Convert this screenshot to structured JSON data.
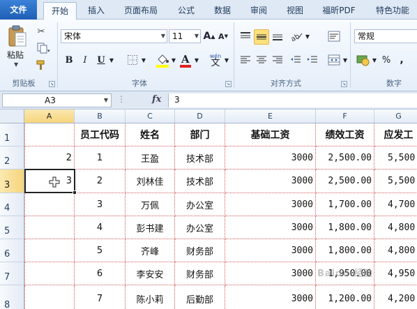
{
  "tabs": [
    {
      "label": "文件"
    },
    {
      "label": "开始"
    },
    {
      "label": "插入"
    },
    {
      "label": "页面布局"
    },
    {
      "label": "公式"
    },
    {
      "label": "数据"
    },
    {
      "label": "审阅"
    },
    {
      "label": "视图"
    },
    {
      "label": "福昕PDF"
    },
    {
      "label": "特色功能"
    }
  ],
  "ribbon": {
    "clipboard": {
      "paste_label": "粘贴",
      "group_label": "剪贴板"
    },
    "font": {
      "font_name": "宋体",
      "font_size": "11",
      "bold": "B",
      "italic": "I",
      "underline": "U",
      "wen": "wén",
      "wen_char": "文",
      "grow": "A",
      "shrink": "A",
      "group_label": "字体"
    },
    "alignment": {
      "group_label": "对齐方式"
    },
    "number": {
      "format": "常规",
      "percent": "%",
      "comma": ",",
      "group_label": "数字"
    }
  },
  "formula_bar": {
    "name_box": "A3",
    "fx_label": "fx",
    "content": "3"
  },
  "columns": [
    "A",
    "B",
    "C",
    "D",
    "E",
    "F",
    "G"
  ],
  "rows": [
    {
      "n": "1",
      "cells": [
        "",
        "员工代码",
        "姓名",
        "部门",
        "基础工资",
        "绩效工资",
        "应发工"
      ]
    },
    {
      "n": "2",
      "cells": [
        "2",
        "1",
        "王盈",
        "技术部",
        "3000",
        "2,500.00",
        "5,500."
      ]
    },
    {
      "n": "3",
      "cells": [
        "3",
        "2",
        "刘林佳",
        "技术部",
        "3000",
        "2,500.00",
        "5,500."
      ]
    },
    {
      "n": "4",
      "cells": [
        "",
        "3",
        "万佩",
        "办公室",
        "3000",
        "1,700.00",
        "4,700."
      ]
    },
    {
      "n": "5",
      "cells": [
        "",
        "4",
        "彭书建",
        "办公室",
        "3000",
        "1,800.00",
        "4,800."
      ]
    },
    {
      "n": "6",
      "cells": [
        "",
        "5",
        "齐峰",
        "财务部",
        "3000",
        "1,800.00",
        "4,800."
      ]
    },
    {
      "n": "7",
      "cells": [
        "",
        "6",
        "李安安",
        "财务部",
        "3000",
        "1,950.00",
        "4,950."
      ]
    },
    {
      "n": "8",
      "cells": [
        "",
        "7",
        "陈小莉",
        "后勤部",
        "3000",
        "1,200.00",
        "4,200."
      ]
    }
  ],
  "selected_cell": "A3",
  "watermark": "Baidu 经验",
  "colors": {
    "file_tab": "#2a6fc9",
    "header_selected": "#f6d47c",
    "highlight_button": "#fbe17c",
    "gridline": "#d05a5a"
  }
}
